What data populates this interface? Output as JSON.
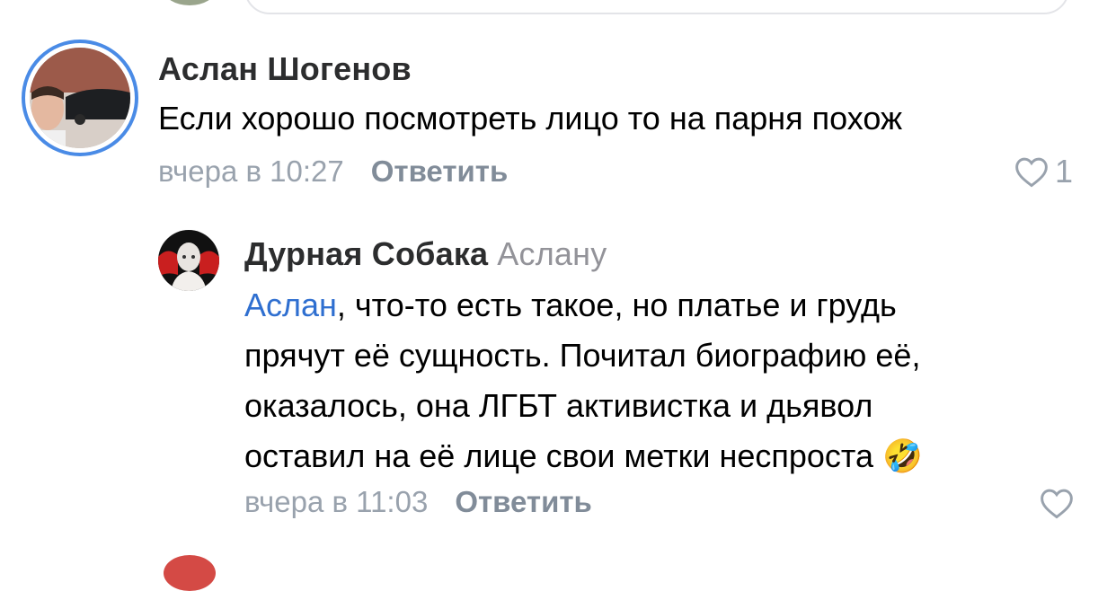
{
  "comment1": {
    "author": "Аслан Шогенов",
    "text": "Если хорошо  посмотреть лицо то на парня похож",
    "time": "вчера в 10:27",
    "reply_label": "Ответить",
    "likes": "1"
  },
  "comment2": {
    "author": "Дурная Собака",
    "reply_to": "Аслану",
    "mention": "Аслан",
    "text_line1_rest": ", что-то есть такое, но платье и грудь",
    "text_line2": "прячут её сущность. Почитал биографию её,",
    "text_line3": "оказалось, она ЛГБТ активистка и дьявол",
    "text_line4": "оставил на её лице свои метки неспроста",
    "emoji": "🤣",
    "time": "вчера в 11:03",
    "reply_label": "Ответить"
  },
  "colors": {
    "accent": "#4a8be6",
    "mention": "#2f6fd0",
    "meta": "#99a2ad"
  }
}
